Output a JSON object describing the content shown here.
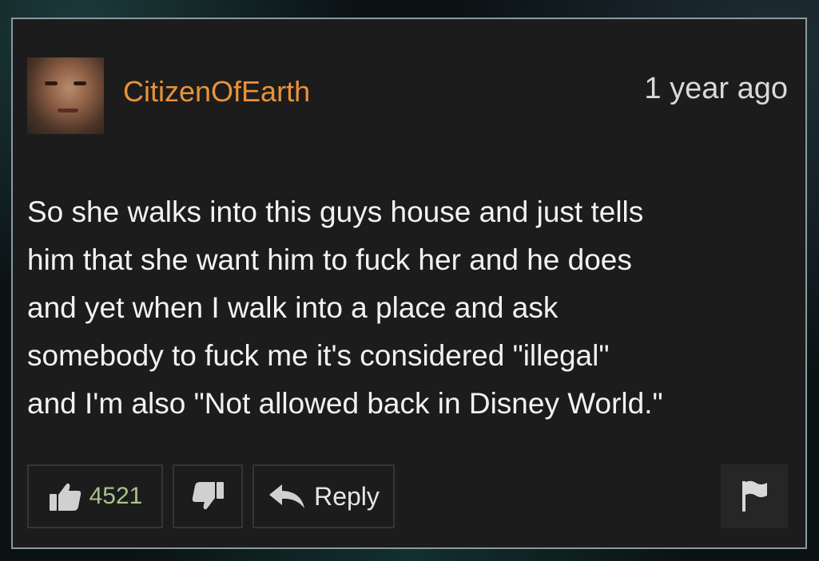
{
  "comment": {
    "username": "CitizenOfEarth",
    "timestamp": "1 year ago",
    "text": "So she walks into this guys house and just tells\nhim that she want him to fuck her and he does\nand yet when I walk into a place and ask\nsomebody to fuck me it's considered \"illegal\"\nand I'm also \"Not allowed back in Disney World.\"",
    "likes": "4521",
    "reply_label": "Reply"
  },
  "icons": {
    "like": "thumbs-up-icon",
    "dislike": "thumbs-down-icon",
    "reply": "reply-arrow-icon",
    "flag": "flag-icon"
  },
  "colors": {
    "username": "#e8923a",
    "likes": "#a9c28a",
    "card_bg": "#1c1c1c",
    "card_border": "#8a9aa0"
  }
}
